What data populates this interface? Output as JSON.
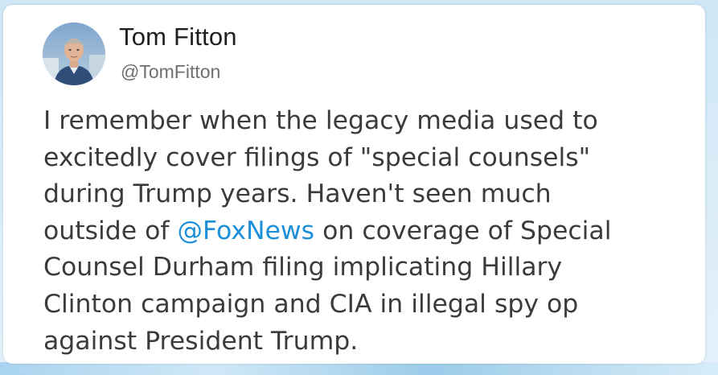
{
  "tweet": {
    "author": {
      "display_name": "Tom Fitton",
      "handle": "@TomFitton",
      "avatar_icon": "profile-photo"
    },
    "text_lines": [
      {
        "before": "I remember when the legacy media used to",
        "mention": "",
        "after": ""
      },
      {
        "before": "excitedly cover filings of \"special counsels\"",
        "mention": "",
        "after": ""
      },
      {
        "before": "during Trump years. Haven't seen much",
        "mention": "",
        "after": ""
      },
      {
        "before": "outside of ",
        "mention": "@FoxNews",
        "after": " on coverage of Special"
      },
      {
        "before": "Counsel Durham filing implicating Hillary",
        "mention": "",
        "after": ""
      },
      {
        "before": "Clinton campaign and CIA in illegal spy op",
        "mention": "",
        "after": ""
      },
      {
        "before": "against President Trump.",
        "mention": "",
        "after": ""
      }
    ]
  },
  "colors": {
    "mention": "#1d8fd8",
    "text": "#3b3b3b",
    "name": "#1f1f1f",
    "handle": "#6f6f6f",
    "background": "#d9ecf8"
  }
}
